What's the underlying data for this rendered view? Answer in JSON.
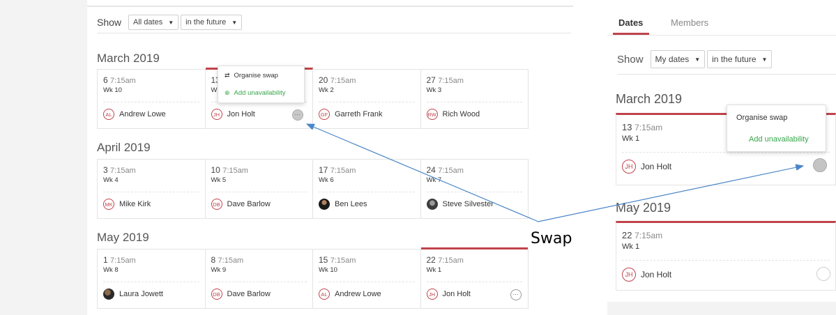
{
  "left": {
    "show_label": "Show",
    "filter_dates": "All dates",
    "filter_time": "in the future",
    "months": [
      {
        "title": "March 2019",
        "cells": [
          {
            "day": "6",
            "time": "7:15am",
            "week": "Wk 10",
            "initials": "AL",
            "name": "Andrew Lowe"
          },
          {
            "day": "13",
            "time": "",
            "week": "Wk 1",
            "initials": "JH",
            "name": "Jon Holt"
          },
          {
            "day": "20",
            "time": "7:15am",
            "week": "Wk 2",
            "initials": "GF",
            "name": "Garreth Frank"
          },
          {
            "day": "27",
            "time": "7:15am",
            "week": "Wk 3",
            "initials": "RW",
            "name": "Rich Wood"
          }
        ]
      },
      {
        "title": "April 2019",
        "cells": [
          {
            "day": "3",
            "time": "7:15am",
            "week": "Wk 4",
            "initials": "MK",
            "name": "Mike Kirk"
          },
          {
            "day": "10",
            "time": "7:15am",
            "week": "Wk 5",
            "initials": "DB",
            "name": "Dave Barlow"
          },
          {
            "day": "17",
            "time": "7:15am",
            "week": "Wk 6",
            "initials": "",
            "name": "Ben Lees"
          },
          {
            "day": "24",
            "time": "7:15am",
            "week": "Wk 7",
            "initials": "",
            "name": "Steve Silvester"
          }
        ]
      },
      {
        "title": "May 2019",
        "cells": [
          {
            "day": "1",
            "time": "7:15am",
            "week": "Wk 8",
            "initials": "",
            "name": "Laura Jowett"
          },
          {
            "day": "8",
            "time": "7:15am",
            "week": "Wk 9",
            "initials": "DB",
            "name": "Dave Barlow"
          },
          {
            "day": "15",
            "time": "7:15am",
            "week": "Wk 10",
            "initials": "AL",
            "name": "Andrew Lowe"
          },
          {
            "day": "22",
            "time": "7:15am",
            "week": "Wk 1",
            "initials": "JH",
            "name": "Jon Holt"
          }
        ]
      }
    ],
    "popover": {
      "swap_label": "Organise swap",
      "unavail_label": "Add unavailability"
    },
    "more_glyph": "···"
  },
  "right": {
    "tabs": [
      "Dates",
      "Members"
    ],
    "show_label": "Show",
    "filter_dates": "My dates",
    "filter_time": "in the future",
    "march": {
      "title": "March 2019",
      "day": "13",
      "time": "7:15am",
      "week": "Wk 1",
      "initials": "JH",
      "name": "Jon Holt"
    },
    "may": {
      "title": "May 2019",
      "day": "22",
      "time": "7:15am",
      "week": "Wk 1",
      "initials": "JH",
      "name": "Jon Holt"
    },
    "popover": {
      "swap_label": "Organise swap",
      "unavail_label": "Add unavailability"
    }
  },
  "annotation": {
    "label": "Swap"
  },
  "colors": {
    "accent_red": "#c0434b",
    "green": "#37a64a",
    "arrow_blue": "#4a86c8"
  },
  "icons": {
    "caret": "▼",
    "swap": "⇄",
    "add": "⊕"
  }
}
